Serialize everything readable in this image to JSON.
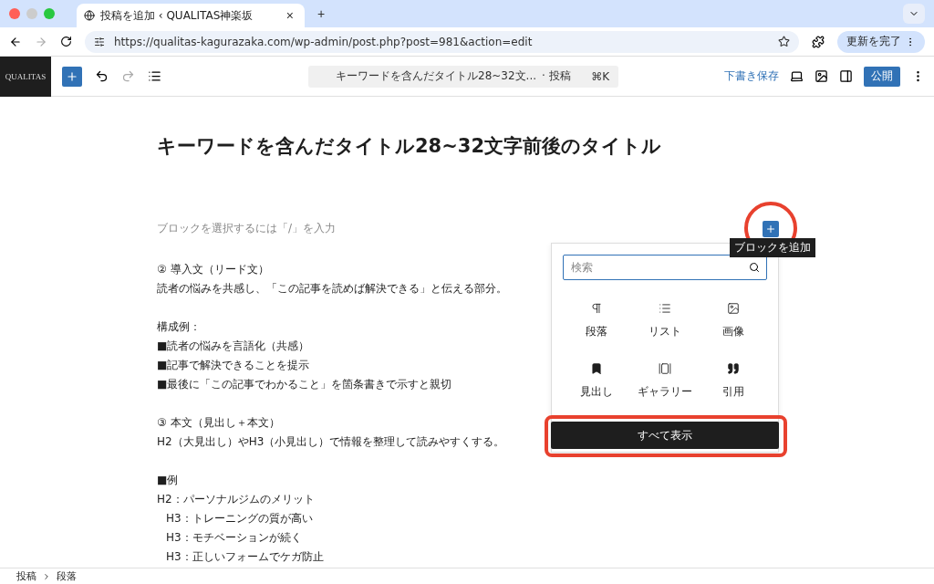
{
  "browser": {
    "tab": {
      "title": "投稿を追加 ‹ QUALITAS神楽坂",
      "close": "×"
    },
    "new_tab": "+",
    "url": "https://qualitas-kagurazaka.com/wp-admin/post.php?post=981&action=edit",
    "update_button": "更新を完了"
  },
  "toolbar": {
    "logo": "QUALITAS",
    "document_bar": {
      "title": "キーワードを含んだタイトル28~32文...",
      "type": "· 投稿",
      "shortcut": "⌘K"
    },
    "save_draft": "下書き保存",
    "publish": "公開"
  },
  "editor": {
    "title": "キーワードを含んだタイトル28~32文字前後のタイトル",
    "placeholder": "ブロックを選択するには「/」を入力",
    "lines": [
      {
        "kind": "text",
        "text": "② 導入文（リード文）"
      },
      {
        "kind": "text",
        "text": "読者の悩みを共感し、「この記事を読めば解決できる」と伝える部分。"
      },
      {
        "kind": "blank"
      },
      {
        "kind": "text",
        "text": "構成例："
      },
      {
        "kind": "text",
        "text": "■読者の悩みを言語化（共感）"
      },
      {
        "kind": "text",
        "text": "■記事で解決できることを提示"
      },
      {
        "kind": "text",
        "text": "■最後に「この記事でわかること」を箇条書きで示すと親切"
      },
      {
        "kind": "blank"
      },
      {
        "kind": "text",
        "text": "③ 本文（見出し＋本文）"
      },
      {
        "kind": "text",
        "text": "H2（大見出し）やH3（小見出し）で情報を整理して読みやすくする。"
      },
      {
        "kind": "blank"
      },
      {
        "kind": "text",
        "text": "■例"
      },
      {
        "kind": "text",
        "text": "H2：パーソナルジムのメリット"
      },
      {
        "kind": "indent",
        "text": "H3：トレーニングの質が高い"
      },
      {
        "kind": "indent",
        "text": "H3：モチベーションが続く"
      },
      {
        "kind": "indent",
        "text": "H3：正しいフォームでケガ防止"
      }
    ]
  },
  "inserter": {
    "tooltip": "ブロックを追加",
    "search": {
      "placeholder": "検索"
    },
    "blocks": [
      {
        "kind": "paragraph",
        "label": "段落"
      },
      {
        "kind": "list",
        "label": "リスト"
      },
      {
        "kind": "image",
        "label": "画像"
      },
      {
        "kind": "heading",
        "label": "見出し"
      },
      {
        "kind": "gallery",
        "label": "ギャラリー"
      },
      {
        "kind": "quote",
        "label": "引用"
      }
    ],
    "show_all": "すべて表示"
  },
  "breadcrumb": [
    {
      "label": "投稿"
    },
    {
      "label": "段落"
    }
  ]
}
